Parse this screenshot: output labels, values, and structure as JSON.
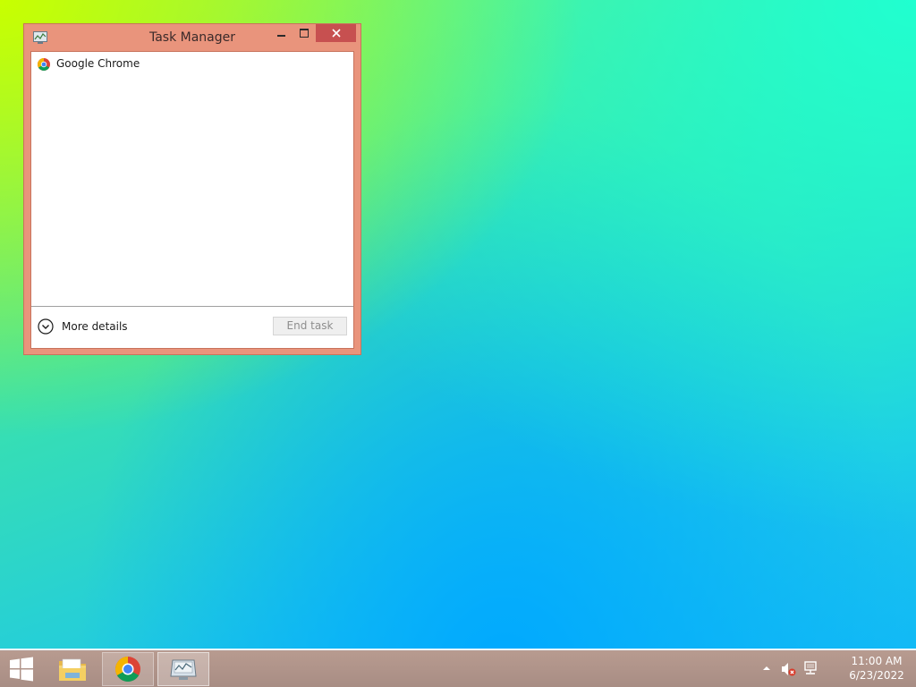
{
  "window": {
    "title": "Task Manager",
    "processes": [
      {
        "name": "Google Chrome",
        "icon": "chrome-icon"
      }
    ],
    "more_details_label": "More details",
    "end_task_label": "End task"
  },
  "taskbar": {
    "apps": [
      {
        "name": "File Explorer",
        "icon": "folder-icon"
      },
      {
        "name": "Google Chrome",
        "icon": "chrome-icon"
      },
      {
        "name": "Task Manager",
        "icon": "task-manager-icon"
      }
    ],
    "clock": {
      "time": "11:00 AM",
      "date": "6/23/2022"
    }
  },
  "colors": {
    "window_frame": "#e9947c",
    "close_button": "#c75050",
    "taskbar": "#b09488"
  }
}
